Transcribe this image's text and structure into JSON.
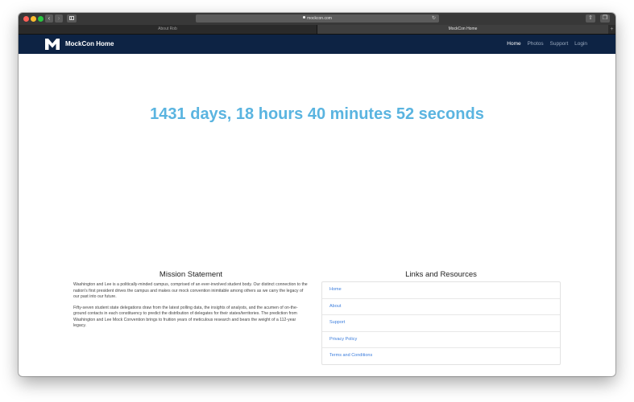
{
  "browser": {
    "url": "mockcon.com",
    "tabs": [
      {
        "label": "About Rob"
      },
      {
        "label": "MockCon Home"
      }
    ]
  },
  "site": {
    "brand": "MockCon Home",
    "nav": [
      {
        "label": "Home",
        "active": true
      },
      {
        "label": "Photos",
        "active": false
      },
      {
        "label": "Support",
        "active": false
      },
      {
        "label": "Login",
        "active": false
      }
    ]
  },
  "countdown": "1431 days, 18 hours 40 minutes 52 seconds",
  "mission": {
    "heading": "Mission Statement",
    "paragraphs": [
      "Washington and Lee is a politically-minded campus, comprised of an ever-involved student body. Our distinct connection to the nation's first president drives the campus and makes our mock convention inimitable among others as we carry the legacy of our past into our future.",
      "Fifty-seven student state delegations draw from the latest polling data, the insights of analysts, and the acumen of on-the-ground contacts in each constituency to predict the distribution of delegates for their states/territories. The prediction from Washington and Lee Mock Convention brings to fruition years of meticulous research and bears the weight of a 112-year legacy."
    ]
  },
  "links": {
    "heading": "Links and Resources",
    "items": [
      "Home",
      "About",
      "Support",
      "Privacy Policy",
      "Terms and Conditions"
    ]
  },
  "colors": {
    "navbar": "#0d2344",
    "countdown": "#5ab4e0",
    "link": "#3b7ddd"
  }
}
